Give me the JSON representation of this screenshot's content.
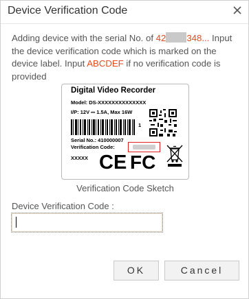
{
  "dialog": {
    "title": "Device Verification Code",
    "message": {
      "part1": "Adding device with the serial No. of ",
      "serial_prefix": "42",
      "serial_suffix": "348...",
      "part2": " Input the device verification code which is marked on the device label. Input ",
      "default_code": "ABCDEF",
      "part3": " if no verification code is provided"
    },
    "label_sketch": {
      "title": "Digital Video Recorder",
      "model": "Model:  DS-XXXXXXXXXXXXXX",
      "ip": "I/P:  12V ⎓ 1.5A, Max 16W",
      "number_one": "1",
      "serial": "Serial No.:  410000007",
      "verification": "Verification Code:",
      "xxxxx": "XXXXX",
      "ce_text": "CE",
      "fc_text": "FC"
    },
    "caption": "Verification Code Sketch",
    "field_label": "Device Verification Code :",
    "field_value": "",
    "buttons": {
      "ok": "OK",
      "cancel": "Cancel"
    }
  }
}
